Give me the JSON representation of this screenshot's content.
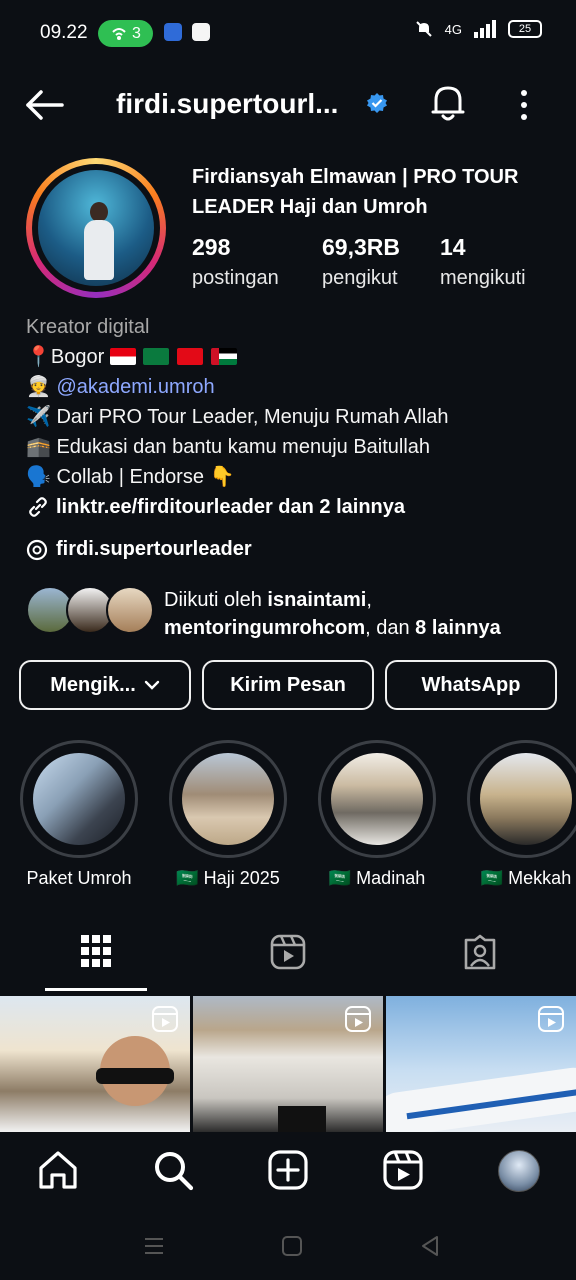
{
  "status_bar": {
    "time": "09.22",
    "hotspot_count": "3",
    "network": "4G",
    "battery": "25"
  },
  "header": {
    "username": "firdi.supertourl...",
    "icons": [
      "back-arrow-icon",
      "verified-badge-icon",
      "bell-icon",
      "more-vertical-icon"
    ]
  },
  "profile": {
    "full_name": "Firdiansyah Elmawan | PRO TOUR LEADER Haji dan Umroh",
    "stats": [
      {
        "value": "298",
        "label": "postingan"
      },
      {
        "value": "69,3RB",
        "label": "pengikut"
      },
      {
        "value": "14",
        "label": "mengikuti"
      }
    ],
    "category": "Kreator digital",
    "bio": {
      "line1_emoji": "📍",
      "line1": "Bogor",
      "line2_emoji": "👳",
      "line2_mention": "@akademi.umroh",
      "line3_emoji": "✈️",
      "line3": "Dari PRO Tour Leader, Menuju Rumah Allah",
      "line4_emoji": "🕋",
      "line4": "Edukasi dan bantu kamu menuju Baitullah",
      "line5_emoji": "🗣️",
      "line5": "Collab | Endorse",
      "line5_tail_emoji": "👇"
    },
    "link_text": "linktr.ee/firditourleader dan 2 lainnya",
    "threads_handle": "firdi.supertourleader",
    "followed_by": {
      "prefix": "Diikuti oleh ",
      "name1": "isnaintami",
      "sep": ",",
      "name2": "mentoringumrohcom",
      "mid": ", dan ",
      "others": "8 lainnya"
    }
  },
  "actions": {
    "following_label": "Mengik...",
    "message_label": "Kirim Pesan",
    "whatsapp_label": "WhatsApp"
  },
  "highlights": [
    {
      "label": "Paket Umroh"
    },
    {
      "label": "🇸🇦 Haji 2025"
    },
    {
      "label": "🇸🇦 Madinah"
    },
    {
      "label": "🇸🇦 Mekkah"
    }
  ],
  "tabs": [
    "grid-icon",
    "reels-icon",
    "tagged-icon"
  ],
  "bottom_nav": [
    "home-icon",
    "search-icon",
    "create-icon",
    "reels-icon",
    "profile-avatar"
  ],
  "colors": {
    "background": "#0c0f14",
    "mention": "#8ea8ff",
    "verified": "#3897f0",
    "hotspot": "#2fbf53"
  }
}
